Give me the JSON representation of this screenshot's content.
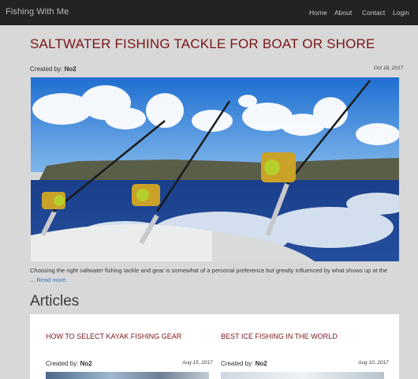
{
  "navbar": {
    "brand": "Fishing With Me",
    "links": [
      "Home",
      "About",
      "Contact",
      "Login"
    ]
  },
  "post": {
    "title": "SALTWATER FISHING TACKLE FOR BOAT OR SHORE",
    "created_by_label": "Created by:",
    "author": "No2",
    "date": "Oct 18, 2017",
    "excerpt": "Choosing the right saltwater fishing tackle and gear is somewhat of a personal preference but greatly influenced by what shows up at the ... ",
    "read_more": "Read more."
  },
  "articles": {
    "heading": "Articles",
    "items": [
      {
        "title": "HOW TO SELECT KAYAK FISHING GEAR",
        "created_by_label": "Created by:",
        "author": "No2",
        "date": "Aug 15, 2017"
      },
      {
        "title": "BEST ICE FISHING IN THE WORLD",
        "created_by_label": "Created by:",
        "author": "No2",
        "date": "Aug 10, 2017"
      }
    ]
  },
  "colors": {
    "navbar": "#232323",
    "title": "#7a1518",
    "link": "#337ab7",
    "page_bg": "#d8d8d8"
  }
}
